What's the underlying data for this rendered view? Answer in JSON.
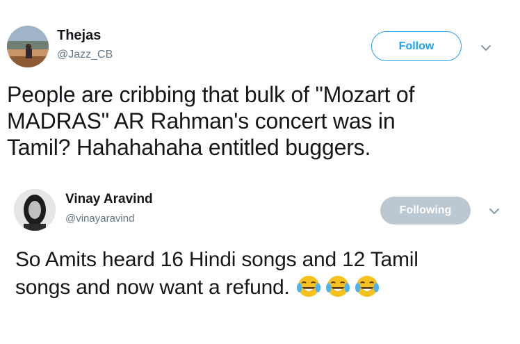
{
  "tweets": [
    {
      "name": "Thejas",
      "handle": "@Jazz_CB",
      "button_label": "Follow",
      "text_lines": [
        "People are cribbing that bulk of \"Mozart of",
        "MADRAS\" AR Rahman's concert was in",
        "Tamil? Hahahahaha entitled buggers."
      ]
    },
    {
      "name": "Vinay Aravind",
      "handle": "@vinayaravind",
      "button_label": "Following",
      "text_lines": [
        "So Amits heard 16 Hindi songs and 12 Tamil",
        "songs and now want a refund."
      ],
      "emojis": [
        "face-with-tears-of-joy-icon",
        "face-with-tears-of-joy-icon",
        "face-with-tears-of-joy-icon"
      ]
    }
  ],
  "colors": {
    "accent": "#1da1f2",
    "following_bg": "#bcc8d1",
    "handle": "#657786",
    "text": "#14171a"
  }
}
